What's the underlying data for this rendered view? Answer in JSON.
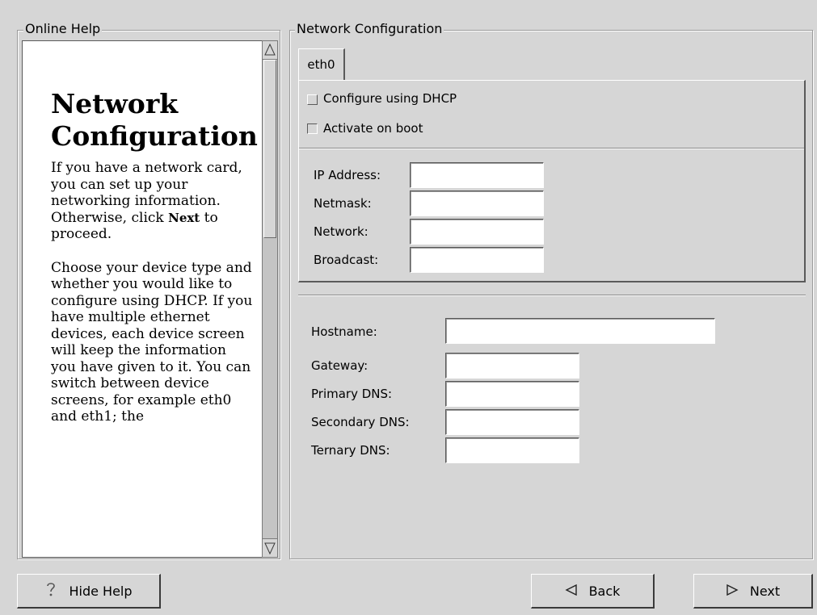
{
  "help_panel": {
    "legend": "Online Help",
    "title": "Network Configuration",
    "paragraph1_before": "If you have a network card, you can set up your networking information. Otherwise, click ",
    "paragraph1_bold": "Next",
    "paragraph1_after": " to proceed.",
    "paragraph2": "Choose your device type and whether you would like to configure using DHCP. If you have multiple ethernet devices, each device screen will keep the information you have given to it. You can switch between device screens, for example eth0 and eth1; the"
  },
  "network_panel": {
    "legend": "Network Configuration",
    "tabs": [
      {
        "label": "eth0"
      }
    ],
    "dhcp_label": "Configure using DHCP",
    "dhcp_checked": false,
    "boot_label": "Activate on boot",
    "boot_checked": true,
    "ip_fields": [
      {
        "label": "IP Address:",
        "value": ""
      },
      {
        "label": "Netmask:",
        "value": ""
      },
      {
        "label": "Network:",
        "value": ""
      },
      {
        "label": "Broadcast:",
        "value": ""
      }
    ],
    "hostname_label": "Hostname:",
    "hostname_value": "",
    "dns_fields": [
      {
        "label": "Gateway:",
        "value": ""
      },
      {
        "label": "Primary DNS:",
        "value": ""
      },
      {
        "label": "Secondary DNS:",
        "value": ""
      },
      {
        "label": "Ternary DNS:",
        "value": ""
      }
    ]
  },
  "buttons": {
    "hide_help": "Hide Help",
    "back": "Back",
    "next": "Next"
  },
  "icons": {
    "help": "help-question-icon",
    "back": "left-triangle-icon",
    "next": "right-triangle-icon"
  }
}
